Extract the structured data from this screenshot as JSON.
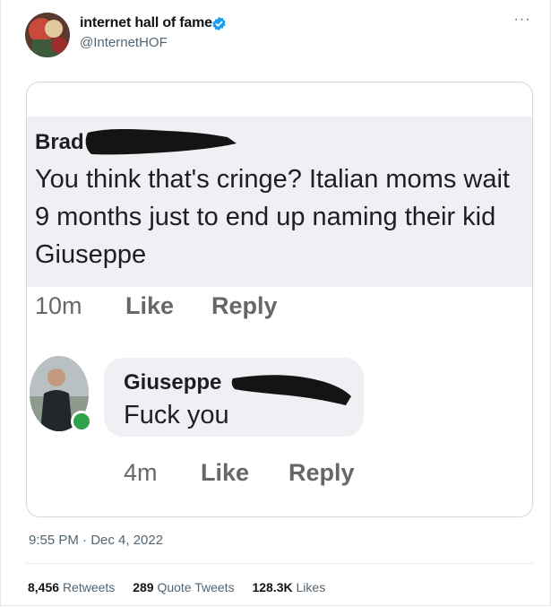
{
  "tweet": {
    "author_name": "internet hall of fame",
    "author_handle": "@InternetHOF",
    "more_label": "···",
    "timestamp": "9:55 PM · Dec 4, 2022",
    "stats": {
      "retweets_count": "8,456",
      "retweets_label": "Retweets",
      "quotes_count": "289",
      "quotes_label": "Quote Tweets",
      "likes_count": "128.3K",
      "likes_label": "Likes"
    }
  },
  "embedded_image": {
    "comment1": {
      "author": "Brad",
      "text": "You think that's cringe? Italian moms wait 9 months just to end up naming their kid Giuseppe",
      "time": "10m",
      "like": "Like",
      "reply": "Reply"
    },
    "comment2": {
      "author": "Giuseppe",
      "text": "Fuck you",
      "time": "4m",
      "like": "Like",
      "reply": "Reply"
    }
  },
  "colors": {
    "verified_blue": "#1d9bf0",
    "muted_text": "#536471",
    "online_green": "#31a24c"
  },
  "icons": [
    "verified-badge-icon",
    "more-options-icon"
  ]
}
